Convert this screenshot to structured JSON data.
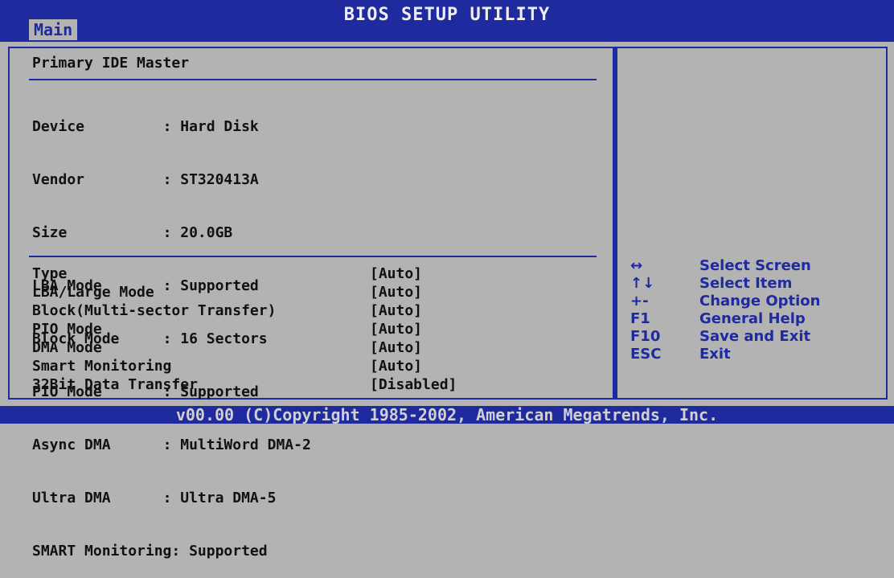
{
  "header": {
    "title": "BIOS SETUP UTILITY",
    "tab_main": "Main"
  },
  "section_title": "Primary IDE Master",
  "device_info": [
    {
      "label": "Device         ",
      "value": ": Hard Disk"
    },
    {
      "label": "Vendor         ",
      "value": ": ST320413A"
    },
    {
      "label": "Size           ",
      "value": ": 20.0GB"
    },
    {
      "label": "LBA Mode       ",
      "value": ": Supported"
    },
    {
      "label": "Block Mode     ",
      "value": ": 16 Sectors"
    },
    {
      "label": "PIO Mode       ",
      "value": ": Supported"
    },
    {
      "label": "Async DMA      ",
      "value": ": MultiWord DMA-2"
    },
    {
      "label": "Ultra DMA      ",
      "value": ": Ultra DMA-5"
    },
    {
      "label": "SMART Monitoring",
      "value": ": Supported"
    }
  ],
  "settings": [
    {
      "name": "Type",
      "value": "[Auto]"
    },
    {
      "name": "LBA/Large Mode",
      "value": "[Auto]"
    },
    {
      "name": "Block(Multi-sector Transfer)",
      "value": "[Auto]"
    },
    {
      "name": "PIO Mode",
      "value": "[Auto]"
    },
    {
      "name": "DMA Mode",
      "value": "[Auto]"
    },
    {
      "name": "Smart Monitoring",
      "value": "[Auto]"
    },
    {
      "name": "32Bit Data Transfer",
      "value": "[Disabled]"
    }
  ],
  "help": [
    {
      "key": "↔",
      "desc": "Select Screen"
    },
    {
      "key": "↑↓",
      "desc": "Select Item"
    },
    {
      "key": "+-",
      "desc": "Change Option"
    },
    {
      "key": "F1",
      "desc": "General Help"
    },
    {
      "key": "F10",
      "desc": "Save and Exit"
    },
    {
      "key": "ESC",
      "desc": "Exit"
    }
  ],
  "footer": "v00.00 (C)Copyright 1985-2002, American Megatrends, Inc."
}
